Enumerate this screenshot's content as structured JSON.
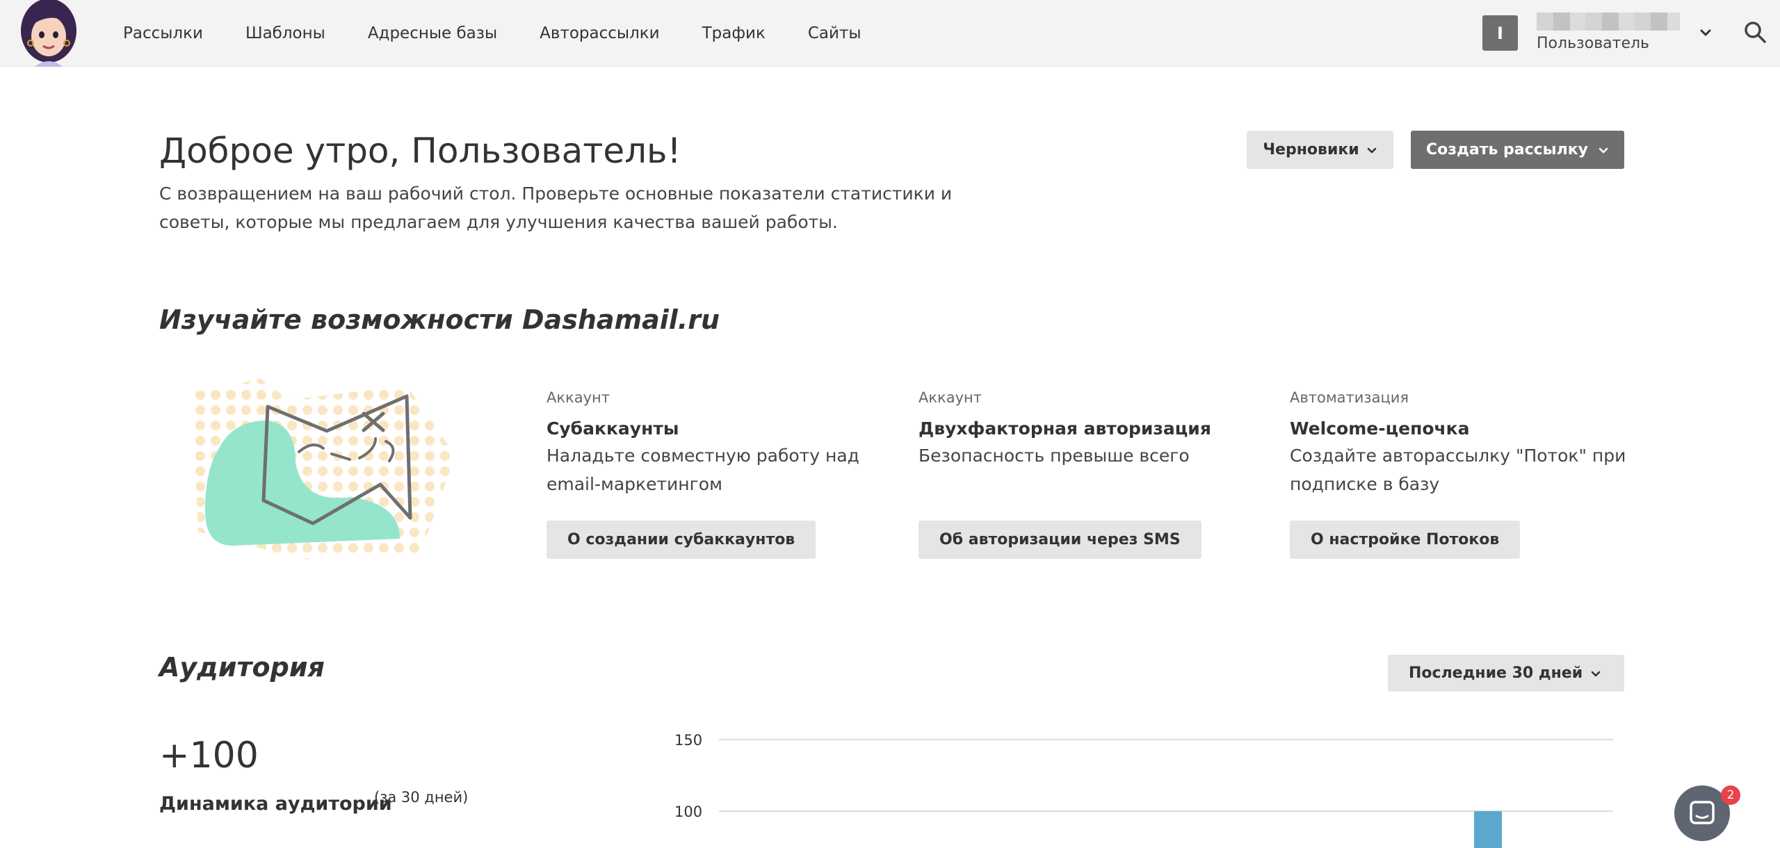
{
  "nav": {
    "items": [
      {
        "label": "Рассылки"
      },
      {
        "label": "Шаблоны"
      },
      {
        "label": "Адресные базы"
      },
      {
        "label": "Авторассылки"
      },
      {
        "label": "Трафик"
      },
      {
        "label": "Сайты"
      }
    ],
    "user_initial": "I",
    "user_role": "Пользователь"
  },
  "greeting": {
    "title": "Доброе утро, Пользователь!",
    "subtitle": "С возвращением на ваш рабочий стол. Проверьте основные показатели статистики и советы, которые мы предлагаем для улучшения качества вашей работы.",
    "drafts_label": "Черновики",
    "create_label": "Создать рассылку"
  },
  "explore": {
    "title": "Изучайте возможности Dashamail.ru",
    "cards": [
      {
        "category": "Аккаунт",
        "title": "Субаккаунты",
        "description": "Наладьте совместную работу над email-маркетингом",
        "button": "О создании субаккаунтов"
      },
      {
        "category": "Аккаунт",
        "title": "Двухфакторная авторизация",
        "description": "Безопасность превыше всего",
        "button": "Об авторизации через SMS"
      },
      {
        "category": "Автоматизация",
        "title": "Welcome-цепочка",
        "description": "Создайте авторассылку \"Поток\" при подписке в базу",
        "button": "О настройке Потоков"
      }
    ]
  },
  "audience": {
    "title": "Аудитория",
    "period": "Последние 30 дней",
    "delta": "+100",
    "label": "Динамика аудитории",
    "label_sub": "(за 30 дней)"
  },
  "chart_data": {
    "type": "bar",
    "yticks": [
      150,
      100
    ],
    "ylim": [
      0,
      150
    ],
    "grid": true,
    "bar_color": "#5aa9cc",
    "bar_position": 0.86,
    "bar_value_visible_top": 100
  },
  "chat": {
    "badge_count": "2"
  },
  "colors": {
    "accent_dark": "#6f6f6f",
    "button_light": "#e5e5e5",
    "mint": "#95e5cc",
    "dots": "#f8e7c2"
  }
}
